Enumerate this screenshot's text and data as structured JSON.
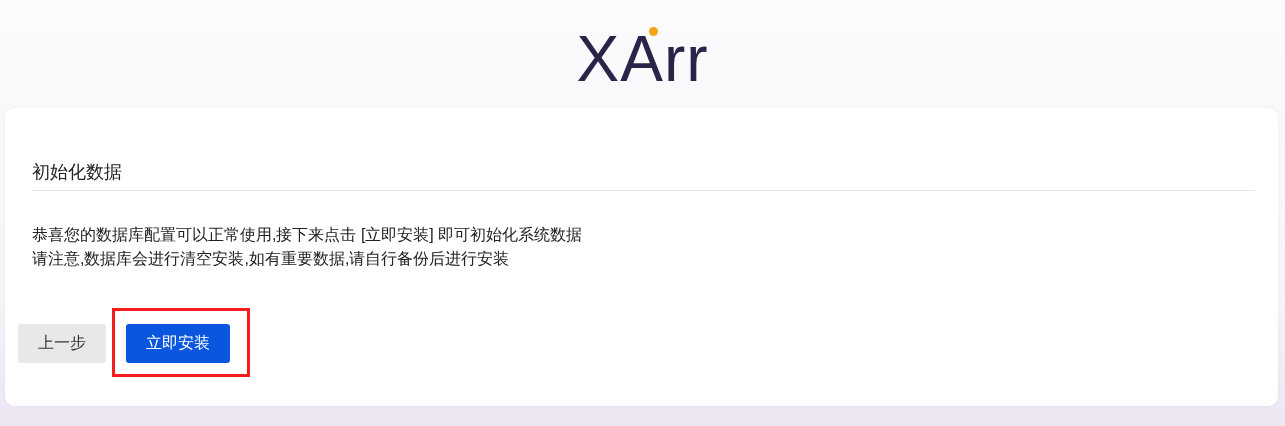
{
  "logo": {
    "text": "XArr"
  },
  "card": {
    "title": "初始化数据",
    "lines": [
      "恭喜您的数据库配置可以正常使用,接下来点击 [立即安装] 即可初始化系统数据",
      "请注意,数据库会进行清空安装,如有重要数据,请自行备份后进行安装"
    ],
    "buttons": [
      {
        "label": "上一步",
        "kind": "secondary",
        "highlighted": false
      },
      {
        "label": "立即安装",
        "kind": "primary",
        "highlighted": true
      }
    ]
  }
}
